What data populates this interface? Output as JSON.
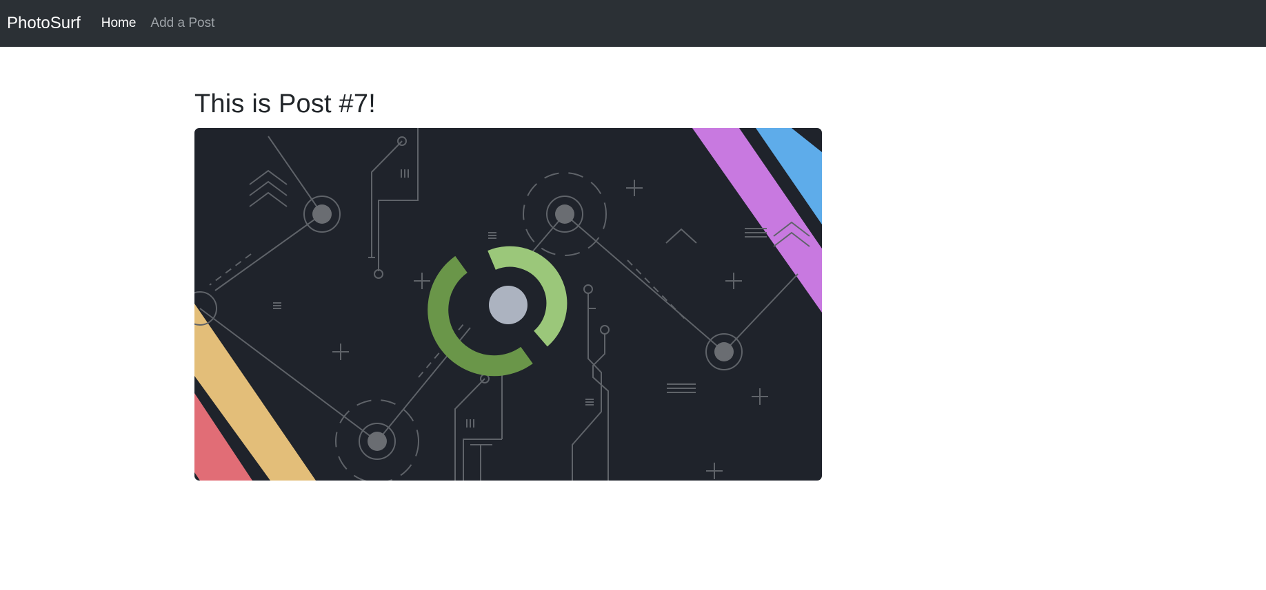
{
  "navbar": {
    "brand": "PhotoSurf",
    "links": [
      {
        "label": "Home",
        "active": true
      },
      {
        "label": "Add a Post",
        "active": false
      }
    ]
  },
  "post": {
    "title": "This is Post #7!",
    "image": {
      "description_icon": "circuit-illustration",
      "colors": {
        "background": "#1f232b",
        "lines": "#5f6369",
        "ring_light": "#9bc77a",
        "ring_dark": "#6a9649",
        "core": "#acb3c0",
        "stripe_pink": "#c879e0",
        "stripe_blue": "#5eacea",
        "stripe_yellow": "#e3be79",
        "stripe_red": "#e16d76"
      }
    }
  }
}
